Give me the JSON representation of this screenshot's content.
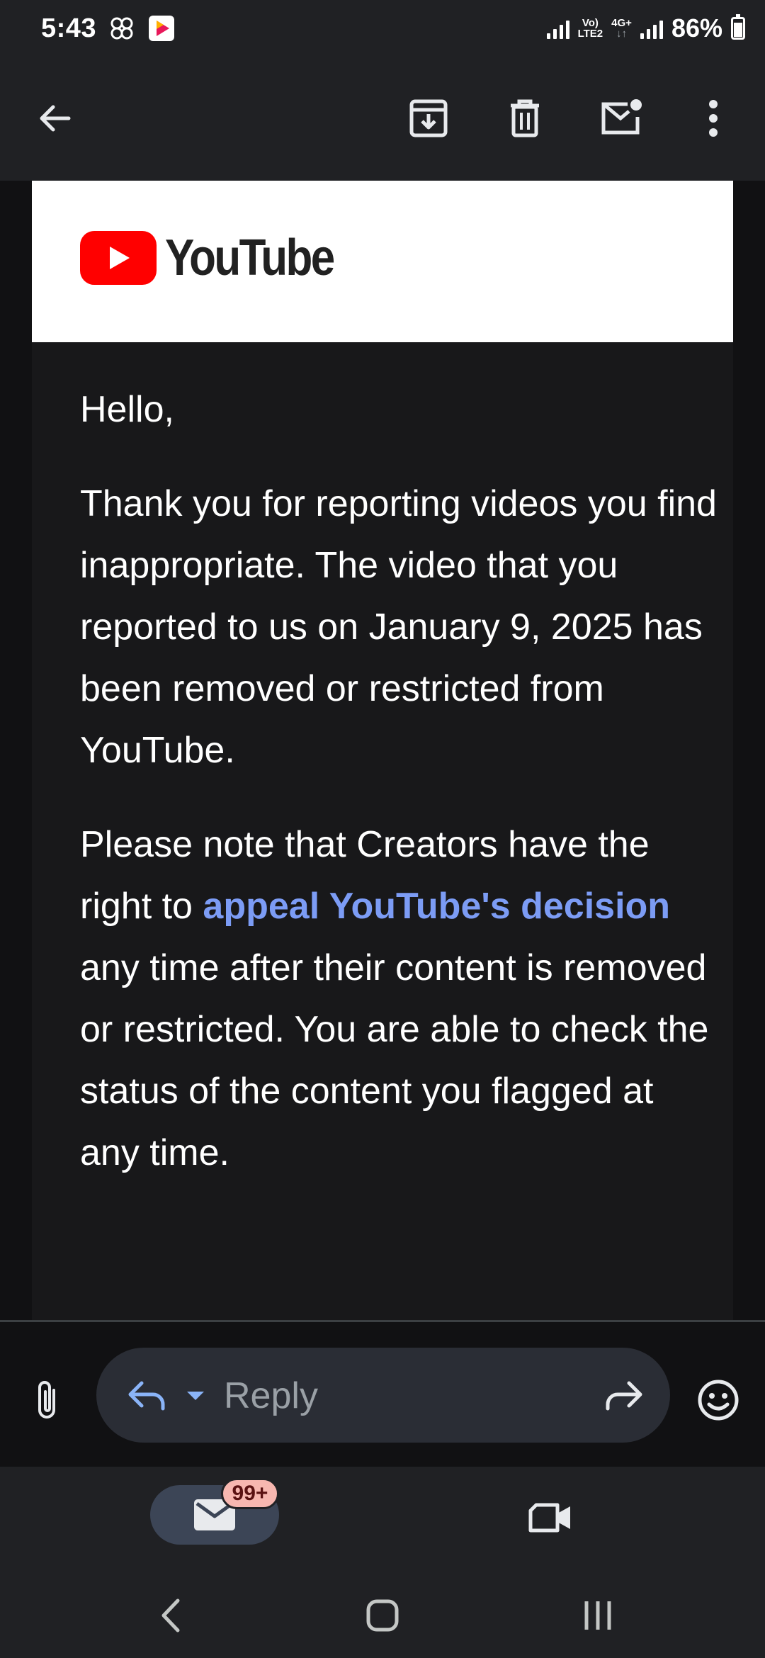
{
  "status_bar": {
    "time": "5:43",
    "net_label_top": "Vo)",
    "net_label_bottom": "LTE2",
    "net_type": "4G+",
    "battery": "86%"
  },
  "toolbar": {
    "icons": [
      "back-arrow-icon",
      "archive-icon",
      "delete-icon",
      "mark-unread-icon",
      "more-vert-icon"
    ]
  },
  "email": {
    "brand": "YouTube",
    "greeting": "Hello,",
    "paragraph1": "Thank you for reporting videos you find inappropriate. The video that you reported to us on January 9, 2025 has been removed or restricted from YouTube.",
    "paragraph2_before": "Please note that Creators have the right to ",
    "paragraph2_link": "appeal YouTube's decision",
    "paragraph2_after": " any time after their content is removed or restricted. You are able to check the status of the content you flagged at any time."
  },
  "reply_bar": {
    "placeholder": "Reply"
  },
  "bottom_nav": {
    "mail_badge": "99+"
  },
  "colors": {
    "background": "#111113",
    "bar": "#202124",
    "link": "#7c9cf5",
    "youtube_red": "#ff0000",
    "badge": "#f7b7b0"
  }
}
